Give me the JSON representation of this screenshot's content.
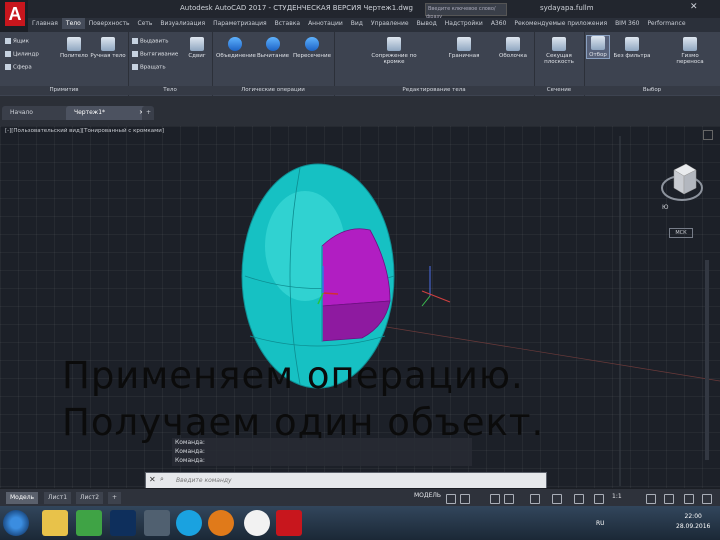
{
  "app": {
    "logo_letter": "A",
    "window_title": "Autodesk AutoCAD 2017 - СТУДЕНЧЕСКАЯ ВЕРСИЯ   Чертеж1.dwg",
    "search_placeholder": "Введите ключевое слово/фразу",
    "user": "sydayapa.fullm"
  },
  "ribbon_tabs": [
    "Главная",
    "Тело",
    "Поверхность",
    "Сеть",
    "Визуализация",
    "Параметризация",
    "Вставка",
    "Аннотации",
    "Вид",
    "Управление",
    "Вывод",
    "Надстройки",
    "A360",
    "Рекомендуемые приложения",
    "BIM 360",
    "Performance"
  ],
  "active_tab_index": 1,
  "panels": {
    "primitives": {
      "title": "Примитив",
      "items": [
        "Ящик",
        "Цилиндр",
        "Сфера"
      ],
      "buttons": [
        "Политело",
        "Ручная тело"
      ]
    },
    "solid": {
      "title": "Тело",
      "items": [
        "Выдавить",
        "Вытягивание",
        "Вращать"
      ],
      "buttons": [
        "Сдвиг"
      ]
    },
    "boolean": {
      "title": "Логические операции",
      "buttons": [
        "Объединение",
        "Вычитание",
        "Пересечение"
      ]
    },
    "editing": {
      "title": "Редактирование тела",
      "buttons": [
        "Сопряжение по кромке",
        "Граничная",
        "Оболочка"
      ]
    },
    "section": {
      "title": "Сечение",
      "buttons": [
        "Секущая плоскость"
      ]
    },
    "selection": {
      "title": "Выбор",
      "buttons": [
        "Отбор",
        "Без фильтра",
        "Гизмо переноса"
      ]
    }
  },
  "doc_tabs": [
    {
      "label": "Начало"
    },
    {
      "label": "Чертеж1*"
    }
  ],
  "viewport_label": "[-][Пользовательский вид][Тонированный с кромками]",
  "viewcube": {
    "wcs_label": "МСК",
    "compass": "Ю"
  },
  "caption": {
    "line1": "Применяем операцию.",
    "line2": "Получаем один объект."
  },
  "command": {
    "history": [
      "Команда:",
      "Команда:",
      "Команда:"
    ],
    "placeholder": "Введите команду"
  },
  "layout_tabs": [
    "Модель",
    "Лист1",
    "Лист2"
  ],
  "status": {
    "model_label": "МОДЕЛЬ",
    "scale": "1:1"
  },
  "taskbar": {
    "time": "22:00",
    "date": "28.09.2016",
    "lang": "RU"
  },
  "colors": {
    "solid": "#1fc9c9",
    "cut": "#b01fc0",
    "accent_red": "#c8161d"
  }
}
